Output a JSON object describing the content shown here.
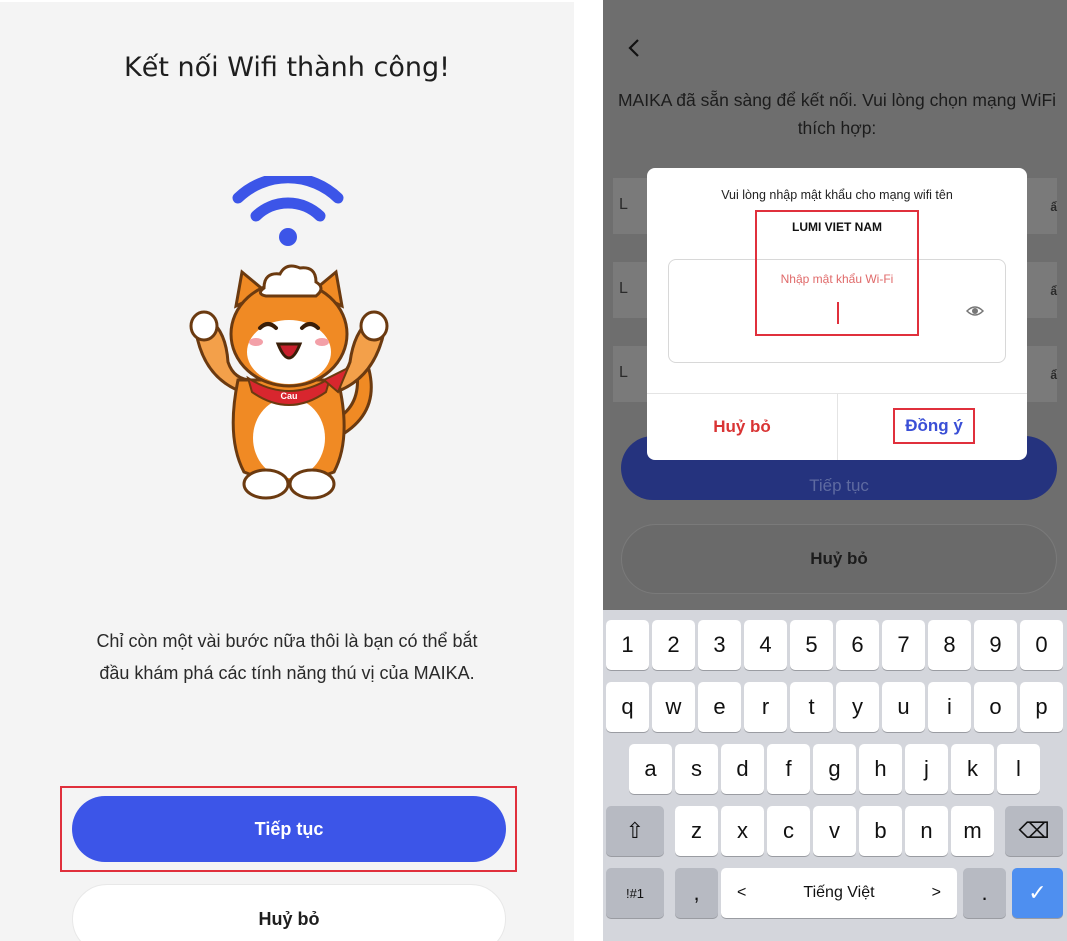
{
  "left": {
    "title": "Kết nối Wifi thành công!",
    "description": "Chỉ còn một vài bước nữa thôi là bạn có thể bắt đầu khám phá các tính năng thú vị của MAIKA.",
    "mascot_badge": "Cau",
    "continue_label": "Tiếp tục",
    "cancel_label": "Huỷ bỏ"
  },
  "right": {
    "back_icon": "chevron-left-icon",
    "prompt": "MAIKA đã sẵn sàng để kết nối. Vui lòng chọn mạng WiFi thích hợp:",
    "continue_label": "Tiếp tục",
    "cancel_label": "Huỷ bỏ",
    "network_rows": [
      {
        "letter": "L",
        "lock": "ẩ"
      },
      {
        "letter": "L",
        "lock": "ẩ"
      },
      {
        "letter": "L",
        "lock": "ẩ"
      }
    ]
  },
  "dialog": {
    "message": "Vui lòng nhập mật khẩu cho mạng wifi tên",
    "network_name": "LUMI VIET NAM",
    "password_placeholder": "Nhập mật khẩu Wi-Fi",
    "cancel_label": "Huỷ bỏ",
    "agree_label": "Đồng ý"
  },
  "keyboard": {
    "row1": [
      "1",
      "2",
      "3",
      "4",
      "5",
      "6",
      "7",
      "8",
      "9",
      "0"
    ],
    "row2": [
      "q",
      "w",
      "e",
      "r",
      "t",
      "y",
      "u",
      "i",
      "o",
      "p"
    ],
    "row3": [
      "a",
      "s",
      "d",
      "f",
      "g",
      "h",
      "j",
      "k",
      "l"
    ],
    "row4": [
      "z",
      "x",
      "c",
      "v",
      "b",
      "n",
      "m"
    ],
    "shift": "⇧",
    "backspace": "⌫",
    "symbols": "!#1",
    "comma": ",",
    "left_arrow": "<",
    "space_label": "Tiếng Việt",
    "right_arrow": ">",
    "period": ".",
    "done": "✓"
  },
  "colors": {
    "primary": "#3c55e8",
    "highlight": "#e0303c",
    "cancel_red": "#d93434"
  }
}
